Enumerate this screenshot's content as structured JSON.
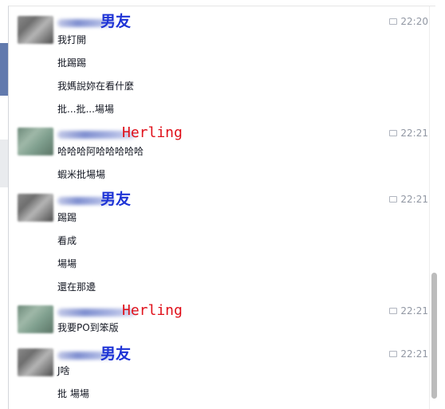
{
  "conversation": [
    {
      "sender": "男友",
      "sender_color": "#1e33d6",
      "time": "22:20",
      "messages": [
        "我打開",
        "批踢踢",
        "我媽說妳在看什麼",
        "批...批...場場"
      ]
    },
    {
      "sender": "Herling",
      "sender_color": "#e0101a",
      "time": "22:21",
      "messages": [
        "哈哈哈阿哈哈哈哈哈",
        "蝦米批場場"
      ]
    },
    {
      "sender": "男友",
      "sender_color": "#1e33d6",
      "time": "22:21",
      "messages": [
        "踢踢",
        "看成",
        "場場",
        "還在那邊"
      ]
    },
    {
      "sender": "Herling",
      "sender_color": "#e0101a",
      "time": "22:21",
      "messages": [
        "我要PO到笨版"
      ]
    },
    {
      "sender": "男友",
      "sender_color": "#1e33d6",
      "time": "22:21",
      "messages": [
        "J啥",
        "批 場場"
      ]
    }
  ],
  "icons": {
    "timestamp": "chat-bubble-icon"
  }
}
